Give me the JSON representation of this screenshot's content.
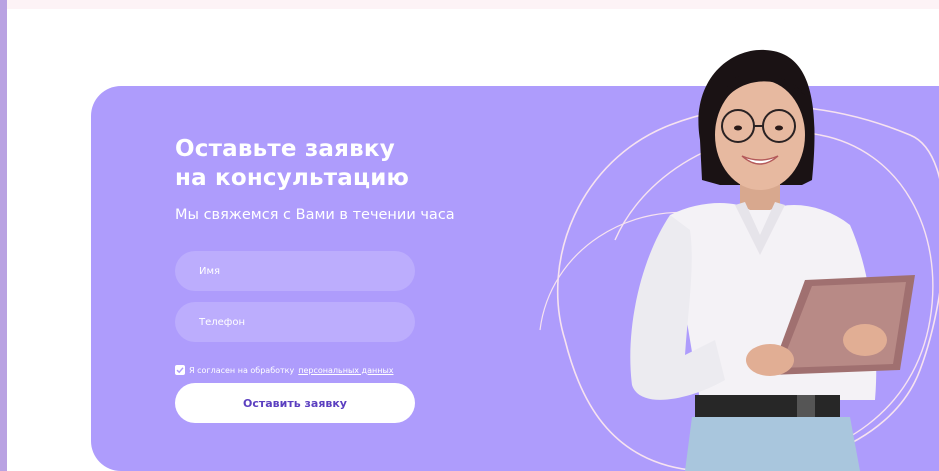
{
  "form": {
    "title_line1": "Оставьте заявку",
    "title_line2": "на консультацию",
    "subtitle": "Мы свяжемся с Вами в течении часа",
    "name_placeholder": "Имя",
    "phone_placeholder": "Телефон",
    "consent_text": "Я согласен на обработку",
    "consent_link": "персональных данных",
    "consent_checked": true,
    "submit_label": "Оставить заявку"
  },
  "colors": {
    "card_background": "#ae9cfc",
    "input_background": "#bcadfd",
    "submit_text": "#5b3fc0",
    "left_strip": "#b9a2e2"
  },
  "icons": {
    "consent_checkbox": "checkmark-icon"
  }
}
